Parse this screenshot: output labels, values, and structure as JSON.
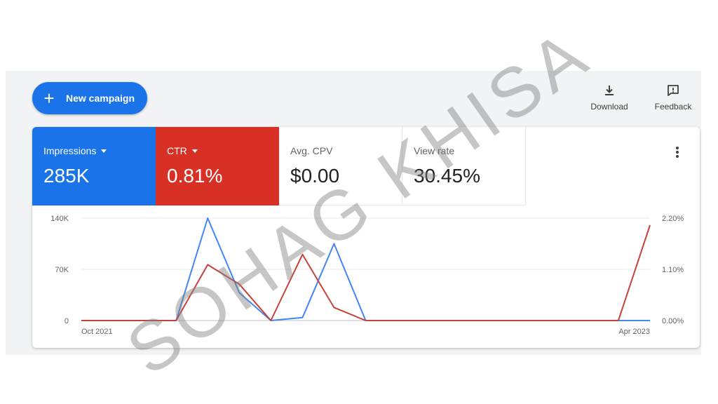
{
  "toolbar": {
    "new_campaign_label": "New campaign",
    "download_label": "Download",
    "feedback_label": "Feedback"
  },
  "metrics": [
    {
      "label": "Impressions",
      "value": "285K",
      "color": "#1a73e8"
    },
    {
      "label": "CTR",
      "value": "0.81%",
      "color": "#d93025"
    },
    {
      "label": "Avg. CPV",
      "value": "$0.00"
    },
    {
      "label": "View rate",
      "value": "30.45%"
    }
  ],
  "chart_data": {
    "type": "line",
    "x_start_label": "Oct 2021",
    "x_end_label": "Apr 2023",
    "y_left_ticks": [
      "0",
      "70K",
      "140K"
    ],
    "y_right_ticks": [
      "0.00%",
      "1.10%",
      "2.20%"
    ],
    "y_left_range": [
      0,
      140000
    ],
    "y_right_range": [
      0,
      2.2
    ],
    "series": [
      {
        "name": "Impressions",
        "color": "#4285f4",
        "axis": "left",
        "values": [
          0,
          0,
          0,
          0,
          140000,
          38000,
          0,
          4000,
          105000,
          0,
          0,
          0,
          0,
          0,
          0,
          0,
          0,
          0,
          0
        ]
      },
      {
        "name": "CTR",
        "color": "#c5423a",
        "axis": "right",
        "values": [
          0,
          0,
          0,
          0,
          1.2,
          0.78,
          0,
          1.42,
          0.28,
          0,
          0,
          0,
          0,
          0,
          0,
          0,
          0,
          0,
          2.05
        ]
      }
    ]
  },
  "watermark": "SOHAG KHISA"
}
